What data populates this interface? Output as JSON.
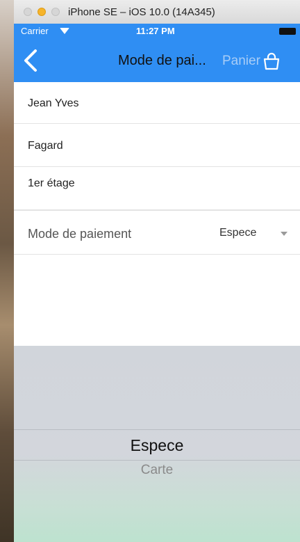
{
  "window": {
    "title": "iPhone SE – iOS 10.0 (14A345)"
  },
  "status_bar": {
    "carrier": "Carrier",
    "time": "11:27 PM"
  },
  "nav": {
    "title": "Mode de pai...",
    "cart_label": "Panier",
    "accent_color": "#2f8ef3"
  },
  "form": {
    "first_name": "Jean Yves",
    "last_name": "Fagard",
    "address_line": "1er étage",
    "payment_label": "Mode de paiement",
    "payment_value": "Espece"
  },
  "picker": {
    "options": [
      "Espece",
      "Carte"
    ],
    "selected": "Espece"
  }
}
